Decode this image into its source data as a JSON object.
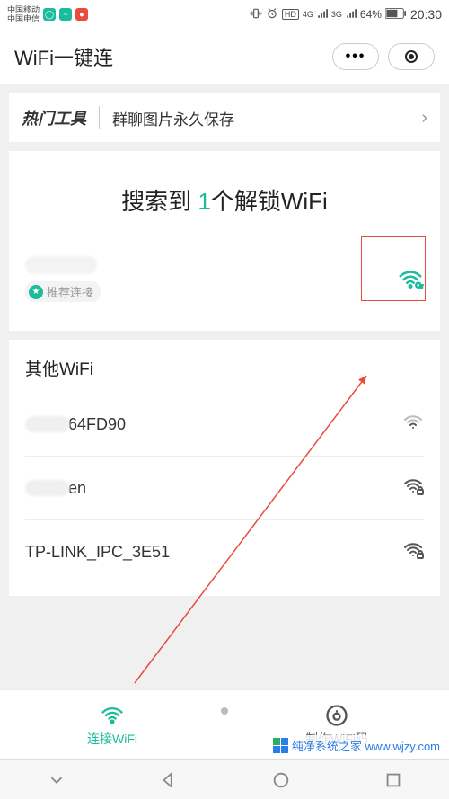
{
  "status": {
    "carrier1": "中国移动",
    "carrier2": "中国电信",
    "battery_pct": "64%",
    "time": "20:30",
    "net_label_hd": "HD",
    "net_label_4g": "4G",
    "net_label_3g": "3G"
  },
  "header": {
    "title": "WiFi一键连"
  },
  "promo": {
    "label": "热门工具",
    "text": "群聊图片永久保存"
  },
  "search": {
    "title_prefix": "搜索到 ",
    "count": "1",
    "title_suffix": "个解锁WiFi",
    "recommend_label": "推荐连接"
  },
  "other": {
    "title": "其他WiFi",
    "items": [
      {
        "name": "64FD90",
        "partial_hidden": true,
        "locked": false
      },
      {
        "name": "en",
        "partial_hidden": true,
        "locked": true
      },
      {
        "name": "TP-LINK_IPC_3E51",
        "partial_hidden": false,
        "locked": true
      }
    ]
  },
  "tabs": {
    "connect": "连接WiFi",
    "make": "制作WiFi码"
  },
  "watermark": "纯净系统之家 www.wjzy.com",
  "colors": {
    "accent": "#1abc9c",
    "annotation": "#e74c3c"
  }
}
